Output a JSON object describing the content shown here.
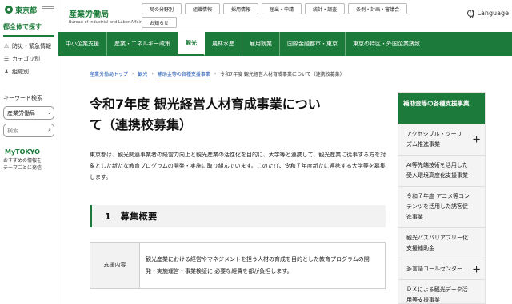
{
  "sidebar": {
    "logo_text": "東京都",
    "title": "都全体で探す",
    "items": [
      {
        "label": "防災・緊急情報",
        "icon": "alert-icon"
      },
      {
        "label": "カテゴリ別",
        "icon": "list-icon"
      },
      {
        "label": "組織別",
        "icon": "org-icon"
      }
    ],
    "keyword_label": "キーワード検索",
    "select_value": "産業労働局",
    "search_placeholder": "検索",
    "mytokyo_title": "MyTOKYO",
    "mytokyo_sub_1": "おすすめの情報を",
    "mytokyo_sub_2": "テーマごとに発信"
  },
  "header": {
    "bureau_jp": "産業労働局",
    "bureau_en": "Bureau of Industrial and Labor Affairs",
    "buttons": [
      "局の分野別",
      "組織情報",
      "採用情報",
      "届出・申請",
      "統計・調査",
      "条例・計画・審議会",
      "お知らせ"
    ],
    "language": "Language"
  },
  "nav": {
    "items": [
      "中小企業支援",
      "産業・エネルギー政策",
      "観光",
      "農林水産",
      "雇用就業",
      "国際金融都市・東京",
      "東京の特区・外国企業誘致"
    ],
    "active_index": 2
  },
  "breadcrumb": {
    "items": [
      "産業労働局トップ",
      "観光",
      "補助金等の各種支援事業"
    ],
    "current": "令和7年度 観光経営人材育成事業について（連携校募集）"
  },
  "page": {
    "title": "令和7年度 観光経営人材育成事業について（連携校募集）",
    "lead": "東京都は、観光関連事業者の経営力向上と観光産業の活性化を目的に、大学等と連携して、観光産業に従事する方を対象とした新たな教育プログラムの開発・実施に取り組んでいます。このたび、令和７年度新たに連携する大学等を募集します。",
    "section_title": "1　募集概要",
    "table": [
      {
        "label": "支援内容",
        "value": "観光産業における経営やマネジメントを担う人材の育成を目的とした教育プログラムの開発・実施運営・事業検証に 必要な経費を都が負担します。"
      }
    ]
  },
  "right_sidebar": {
    "title": "補助金等の各種支援事業",
    "items": [
      {
        "label": "アクセシブル・ツーリズム推進事業",
        "expandable": true
      },
      {
        "label": "AI等先端技術を活用した受入環境高度化支援事業",
        "expandable": false
      },
      {
        "label": "令和７年度 アニメ等コンテンツを活用した誘客促進事業",
        "expandable": false
      },
      {
        "label": "観光バスバリアフリー化支援補助金",
        "expandable": false
      },
      {
        "label": "多言語コールセンター",
        "expandable": true
      },
      {
        "label": "ＤＸによる観光データ活用等支援事業",
        "expandable": false
      }
    ]
  },
  "colors": {
    "brand_green": "#1c7b3a",
    "link_blue": "#1a56b5"
  }
}
